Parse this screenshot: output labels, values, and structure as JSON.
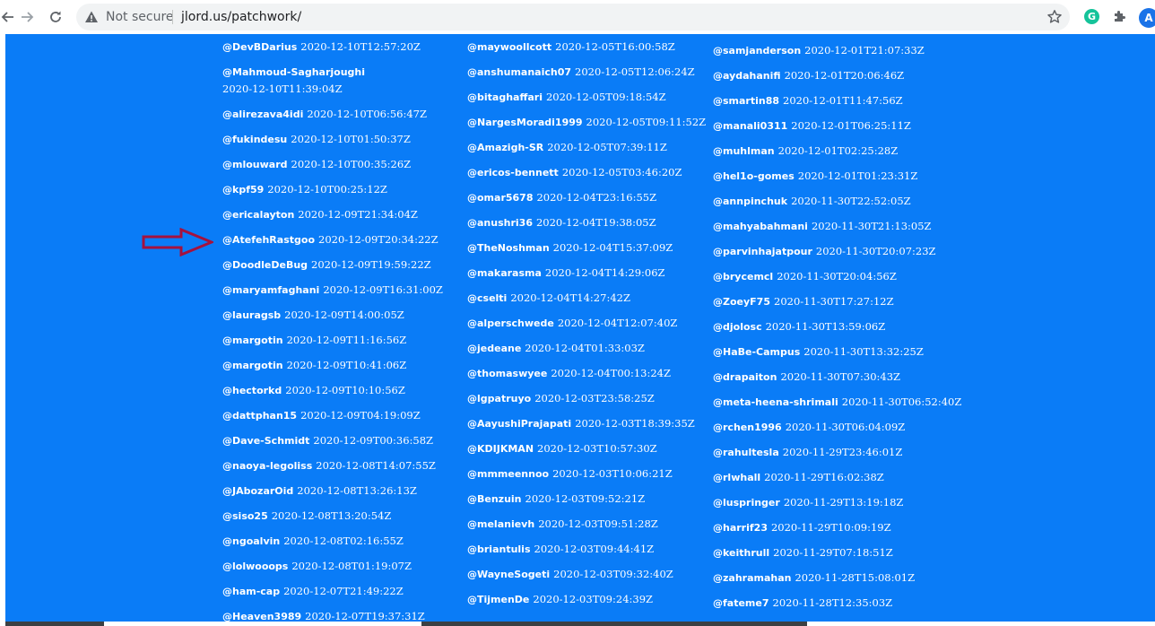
{
  "browser": {
    "security_label": "Not secure",
    "url": "jlord.us/patchwork/",
    "avatar_letter": "A",
    "grammarly_letter": "G",
    "icons": [
      "back-arrow-icon",
      "forward-arrow-icon",
      "reload-icon",
      "warning-icon",
      "star-icon",
      "grammarly-icon",
      "extensions-puzzle-icon"
    ]
  },
  "colors": {
    "page_background": "#0a7cf7",
    "text": "#ffffff",
    "arrow_outline": "#a4123f"
  },
  "columns": [
    {
      "entries": [
        {
          "handle": "@DevBDarius",
          "time": "2020-12-10T12:57:20Z"
        },
        {
          "handle": "@Mahmoud-Sagharjoughi",
          "time": "2020-12-10T11:39:04Z"
        },
        {
          "handle": "@alirezava4idi",
          "time": "2020-12-10T06:56:47Z"
        },
        {
          "handle": "@fukindesu",
          "time": "2020-12-10T01:50:37Z"
        },
        {
          "handle": "@mlouward",
          "time": "2020-12-10T00:35:26Z"
        },
        {
          "handle": "@kpf59",
          "time": "2020-12-10T00:25:12Z"
        },
        {
          "handle": "@ericalayton",
          "time": "2020-12-09T21:34:04Z"
        },
        {
          "handle": "@AtefehRastgoo",
          "time": "2020-12-09T20:34:22Z"
        },
        {
          "handle": "@DoodleDeBug",
          "time": "2020-12-09T19:59:22Z"
        },
        {
          "handle": "@maryamfaghani",
          "time": "2020-12-09T16:31:00Z"
        },
        {
          "handle": "@lauragsb",
          "time": "2020-12-09T14:00:05Z"
        },
        {
          "handle": "@margotin",
          "time": "2020-12-09T11:16:56Z"
        },
        {
          "handle": "@margotin",
          "time": "2020-12-09T10:41:06Z"
        },
        {
          "handle": "@hectorkd",
          "time": "2020-12-09T10:10:56Z"
        },
        {
          "handle": "@dattphan15",
          "time": "2020-12-09T04:19:09Z"
        },
        {
          "handle": "@Dave-Schmidt",
          "time": "2020-12-09T00:36:58Z"
        },
        {
          "handle": "@naoya-legoliss",
          "time": "2020-12-08T14:07:55Z"
        },
        {
          "handle": "@JAbozarOid",
          "time": "2020-12-08T13:26:13Z"
        },
        {
          "handle": "@siso25",
          "time": "2020-12-08T13:20:54Z"
        },
        {
          "handle": "@ngoalvin",
          "time": "2020-12-08T02:16:55Z"
        },
        {
          "handle": "@lolwooops",
          "time": "2020-12-08T01:19:07Z"
        },
        {
          "handle": "@ham-cap",
          "time": "2020-12-07T21:49:22Z"
        },
        {
          "handle": "@Heaven3989",
          "time": "2020-12-07T19:37:31Z"
        }
      ]
    },
    {
      "entries": [
        {
          "handle": "@maywoollcott",
          "time": "2020-12-05T16:00:58Z"
        },
        {
          "handle": "@anshumanaich07",
          "time": "2020-12-05T12:06:24Z"
        },
        {
          "handle": "@bitaghaffari",
          "time": "2020-12-05T09:18:54Z"
        },
        {
          "handle": "@NargesMoradi1999",
          "time": "2020-12-05T09:11:52Z"
        },
        {
          "handle": "@Amazigh-SR",
          "time": "2020-12-05T07:39:11Z"
        },
        {
          "handle": "@ericos-bennett",
          "time": "2020-12-05T03:46:20Z"
        },
        {
          "handle": "@omar5678",
          "time": "2020-12-04T23:16:55Z"
        },
        {
          "handle": "@anushri36",
          "time": "2020-12-04T19:38:05Z"
        },
        {
          "handle": "@TheNoshman",
          "time": "2020-12-04T15:37:09Z"
        },
        {
          "handle": "@makarasma",
          "time": "2020-12-04T14:29:06Z"
        },
        {
          "handle": "@cselti",
          "time": "2020-12-04T14:27:42Z"
        },
        {
          "handle": "@alperschwede",
          "time": "2020-12-04T12:07:40Z"
        },
        {
          "handle": "@jedeane",
          "time": "2020-12-04T01:33:03Z"
        },
        {
          "handle": "@thomaswyee",
          "time": "2020-12-04T00:13:24Z"
        },
        {
          "handle": "@lgpatruyo",
          "time": "2020-12-03T23:58:25Z"
        },
        {
          "handle": "@AayushiPrajapati",
          "time": "2020-12-03T18:39:35Z"
        },
        {
          "handle": "@KDIJKMAN",
          "time": "2020-12-03T10:57:30Z"
        },
        {
          "handle": "@mmmeennoo",
          "time": "2020-12-03T10:06:21Z"
        },
        {
          "handle": "@Benzuin",
          "time": "2020-12-03T09:52:21Z"
        },
        {
          "handle": "@melanievh",
          "time": "2020-12-03T09:51:28Z"
        },
        {
          "handle": "@briantulis",
          "time": "2020-12-03T09:44:41Z"
        },
        {
          "handle": "@WayneSogeti",
          "time": "2020-12-03T09:32:40Z"
        },
        {
          "handle": "@TijmenDe",
          "time": "2020-12-03T09:24:39Z"
        }
      ]
    },
    {
      "entries": [
        {
          "handle": "@samjanderson",
          "time": "2020-12-01T21:07:33Z"
        },
        {
          "handle": "@aydahanifi",
          "time": "2020-12-01T20:06:46Z"
        },
        {
          "handle": "@smartin88",
          "time": "2020-12-01T11:47:56Z"
        },
        {
          "handle": "@manali0311",
          "time": "2020-12-01T06:25:11Z"
        },
        {
          "handle": "@muhlman",
          "time": "2020-12-01T02:25:28Z"
        },
        {
          "handle": "@hel1o-gomes",
          "time": "2020-12-01T01:23:31Z"
        },
        {
          "handle": "@annpinchuk",
          "time": "2020-11-30T22:52:05Z"
        },
        {
          "handle": "@mahyabahmani",
          "time": "2020-11-30T21:13:05Z"
        },
        {
          "handle": "@parvinhajatpour",
          "time": "2020-11-30T20:07:23Z"
        },
        {
          "handle": "@brycemcl",
          "time": "2020-11-30T20:04:56Z"
        },
        {
          "handle": "@ZoeyF75",
          "time": "2020-11-30T17:27:12Z"
        },
        {
          "handle": "@djolosc",
          "time": "2020-11-30T13:59:06Z"
        },
        {
          "handle": "@HaBe-Campus",
          "time": "2020-11-30T13:32:25Z"
        },
        {
          "handle": "@drapaiton",
          "time": "2020-11-30T07:30:43Z"
        },
        {
          "handle": "@meta-heena-shrimali",
          "time": "2020-11-30T06:52:40Z"
        },
        {
          "handle": "@rchen1996",
          "time": "2020-11-30T06:04:09Z"
        },
        {
          "handle": "@rahultesla",
          "time": "2020-11-29T23:46:01Z"
        },
        {
          "handle": "@rlwhall",
          "time": "2020-11-29T16:02:38Z"
        },
        {
          "handle": "@luspringer",
          "time": "2020-11-29T13:19:18Z"
        },
        {
          "handle": "@harrif23",
          "time": "2020-11-29T10:09:19Z"
        },
        {
          "handle": "@keithrull",
          "time": "2020-11-29T07:18:51Z"
        },
        {
          "handle": "@zahramahan",
          "time": "2020-11-28T15:08:01Z"
        },
        {
          "handle": "@fateme7",
          "time": "2020-11-28T12:35:03Z"
        }
      ]
    }
  ]
}
